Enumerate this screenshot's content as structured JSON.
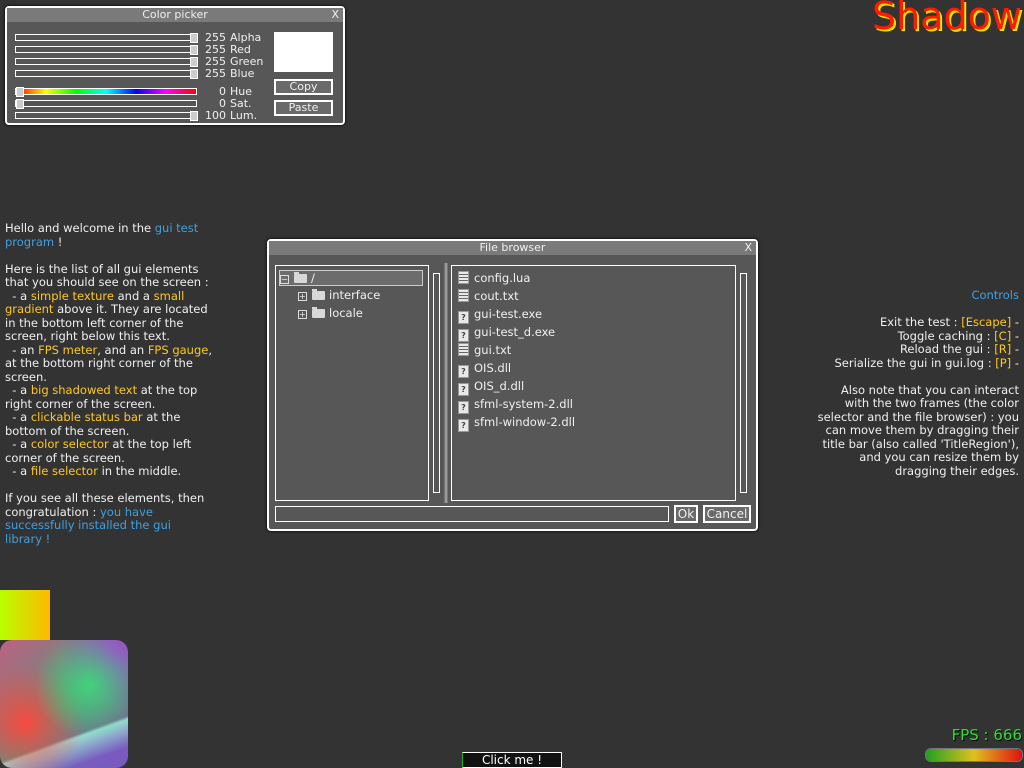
{
  "color_picker": {
    "title": "Color picker",
    "close_label": "X",
    "channels": [
      {
        "name": "Alpha",
        "value": "255",
        "fraction": 1.0
      },
      {
        "name": "Red",
        "value": "255",
        "fraction": 1.0
      },
      {
        "name": "Green",
        "value": "255",
        "fraction": 1.0
      },
      {
        "name": "Blue",
        "value": "255",
        "fraction": 1.0
      }
    ],
    "hsl": [
      {
        "name": "Hue",
        "value": "0",
        "fraction": 0.0
      },
      {
        "name": "Sat.",
        "value": "0",
        "fraction": 0.0
      },
      {
        "name": "Lum.",
        "value": "100",
        "fraction": 1.0
      }
    ],
    "preview_color": "#ffffff",
    "copy_label": "Copy",
    "paste_label": "Paste"
  },
  "shadow_text": "Shadow",
  "welcome": {
    "lines": [
      [
        {
          "t": "Hello and welcome in the "
        },
        {
          "t": "gui test",
          "c": "blue"
        }
      ],
      [
        {
          "t": "program",
          "c": "blue"
        },
        {
          "t": " !"
        }
      ],
      [
        {
          "t": ""
        }
      ],
      [
        {
          "t": "Here is the list of all gui elements"
        }
      ],
      [
        {
          "t": "that you should see on the screen :"
        }
      ],
      [
        {
          "t": "  - a "
        },
        {
          "t": "simple texture",
          "c": "yel"
        },
        {
          "t": " and a "
        },
        {
          "t": "small",
          "c": "yel"
        }
      ],
      [
        {
          "t": "gradient",
          "c": "yel"
        },
        {
          "t": " above it. They are located"
        }
      ],
      [
        {
          "t": "in the bottom left corner of the"
        }
      ],
      [
        {
          "t": "screen, right below this text."
        }
      ],
      [
        {
          "t": "  - an "
        },
        {
          "t": "FPS meter",
          "c": "yel"
        },
        {
          "t": ", and an "
        },
        {
          "t": "FPS gauge",
          "c": "yel"
        },
        {
          "t": ","
        }
      ],
      [
        {
          "t": "at the bottom right corner of the"
        }
      ],
      [
        {
          "t": "screen."
        }
      ],
      [
        {
          "t": "  - a "
        },
        {
          "t": "big shadowed text",
          "c": "yel"
        },
        {
          "t": " at the top"
        }
      ],
      [
        {
          "t": "right corner of the screen."
        }
      ],
      [
        {
          "t": "  - a "
        },
        {
          "t": "clickable status bar",
          "c": "yel"
        },
        {
          "t": " at the"
        }
      ],
      [
        {
          "t": "bottom of the screen."
        }
      ],
      [
        {
          "t": "  - a "
        },
        {
          "t": "color selector",
          "c": "yel"
        },
        {
          "t": " at the top left"
        }
      ],
      [
        {
          "t": "corner of the screen."
        }
      ],
      [
        {
          "t": "  - a "
        },
        {
          "t": "file selector",
          "c": "yel"
        },
        {
          "t": " in the middle."
        }
      ],
      [
        {
          "t": ""
        }
      ],
      [
        {
          "t": "If you see all these elements, then"
        }
      ],
      [
        {
          "t": "congratulation : "
        },
        {
          "t": "you have",
          "c": "blue"
        }
      ],
      [
        {
          "t": "successfully installed the gui",
          "c": "blue"
        }
      ],
      [
        {
          "t": "library !",
          "c": "blue"
        }
      ]
    ]
  },
  "controls": {
    "lines": [
      [
        {
          "t": "Controls",
          "c": "blue"
        }
      ],
      [
        {
          "t": ""
        }
      ],
      [
        {
          "t": "Exit the test : "
        },
        {
          "t": "[Escape]",
          "c": "yel"
        },
        {
          "t": " -"
        }
      ],
      [
        {
          "t": "Toggle caching : "
        },
        {
          "t": "[C]",
          "c": "yel"
        },
        {
          "t": " -"
        }
      ],
      [
        {
          "t": "Reload the gui : "
        },
        {
          "t": "[R]",
          "c": "yel"
        },
        {
          "t": " -"
        }
      ],
      [
        {
          "t": "Serialize the gui in gui.log : "
        },
        {
          "t": "[P]",
          "c": "yel"
        },
        {
          "t": " -"
        }
      ],
      [
        {
          "t": ""
        }
      ],
      [
        {
          "t": "Also note that you can interact"
        }
      ],
      [
        {
          "t": "with the two frames (the color"
        }
      ],
      [
        {
          "t": "selector and the file browser) : you"
        }
      ],
      [
        {
          "t": "can move them by dragging their"
        }
      ],
      [
        {
          "t": "title bar (also called 'TitleRegion'),"
        }
      ],
      [
        {
          "t": "and you can resize them by"
        }
      ],
      [
        {
          "t": "dragging their edges."
        }
      ]
    ]
  },
  "file_browser": {
    "title": "File browser",
    "close_label": "X",
    "tree": [
      {
        "label": "/",
        "expander": "−",
        "level": 0,
        "selected": true
      },
      {
        "label": "interface",
        "expander": "+",
        "level": 1
      },
      {
        "label": "locale",
        "expander": "+",
        "level": 1
      }
    ],
    "files": [
      {
        "name": "config.lua",
        "icon": "text-file-icon"
      },
      {
        "name": "cout.txt",
        "icon": "text-file-icon"
      },
      {
        "name": "gui-test.exe",
        "icon": "unknown-file-icon"
      },
      {
        "name": "gui-test_d.exe",
        "icon": "unknown-file-icon"
      },
      {
        "name": "gui.txt",
        "icon": "text-file-icon"
      },
      {
        "name": "OIS.dll",
        "icon": "unknown-file-icon"
      },
      {
        "name": "OIS_d.dll",
        "icon": "unknown-file-icon"
      },
      {
        "name": "sfml-system-2.dll",
        "icon": "unknown-file-icon"
      },
      {
        "name": "sfml-window-2.dll",
        "icon": "unknown-file-icon"
      }
    ],
    "path_value": "",
    "ok_label": "Ok",
    "cancel_label": "Cancel"
  },
  "fps": {
    "label": "FPS : 666",
    "gauge_fraction": 1.0
  },
  "status_bar": {
    "label": "Click me !"
  }
}
